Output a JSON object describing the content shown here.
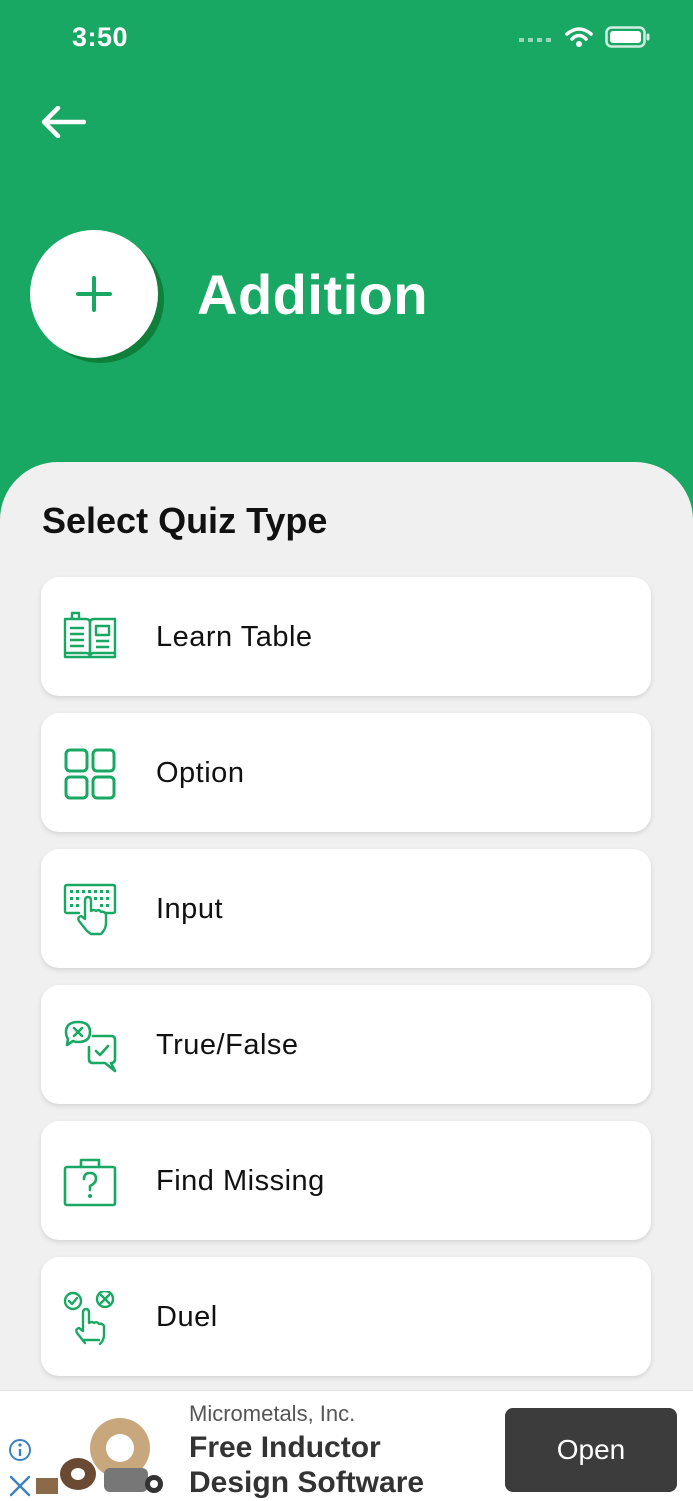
{
  "status_bar": {
    "time": "3:50"
  },
  "header": {
    "title": "Addition",
    "operator_symbol": "+"
  },
  "section_title": "Select Quiz Type",
  "quiz_types": [
    {
      "label": "Learn Table",
      "icon": "book-icon"
    },
    {
      "label": "Option",
      "icon": "grid-icon"
    },
    {
      "label": "Input",
      "icon": "keyboard-tap-icon"
    },
    {
      "label": "True/False",
      "icon": "chat-check-cross-icon"
    },
    {
      "label": "Find Missing",
      "icon": "question-box-icon"
    },
    {
      "label": "Duel",
      "icon": "duel-tap-icon"
    }
  ],
  "ad": {
    "advertiser": "Micrometals, Inc.",
    "headline": "Free Inductor Design Software",
    "cta": "Open"
  },
  "colors": {
    "primary": "#19a864",
    "accent_dark": "#0f7f3a",
    "sheet_bg": "#f0f0f0"
  }
}
